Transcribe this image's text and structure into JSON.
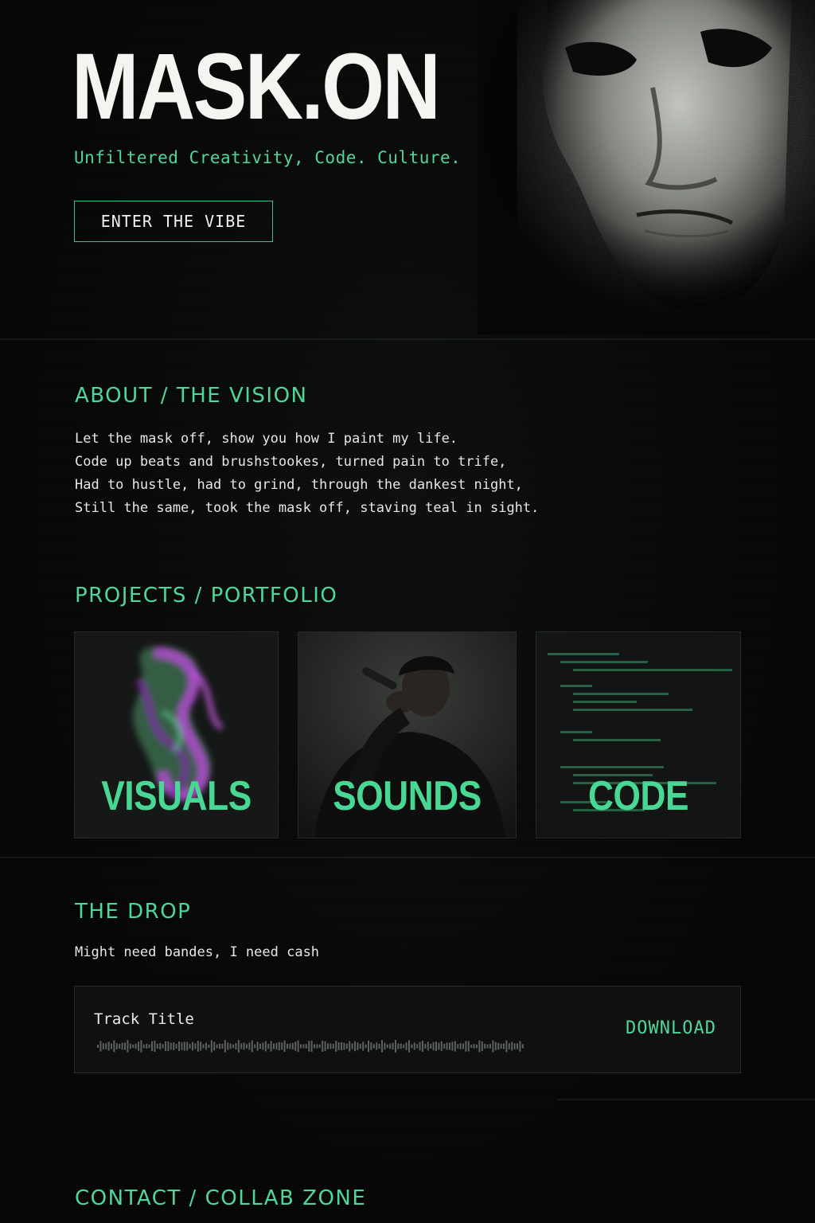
{
  "hero": {
    "title": "MASK.ON",
    "tagline": "Unfiltered Creativity, Code. Culture.",
    "cta_label": "ENTER THE VIBE"
  },
  "about": {
    "heading": "ABOUT / THE VISION",
    "lines": [
      "Let the mask off, show you how I paint my life.",
      "Code up beats and brushstookes, turned pain to trife,",
      "Had to hustle, had to grind, through the dankest night,",
      "Still the same, took the mask off, staving teal in sight."
    ]
  },
  "projects": {
    "heading": "PROJECTS / PORTFOLIO",
    "cards": [
      {
        "label": "VISUALS"
      },
      {
        "label": "SOUNDS"
      },
      {
        "label": "CODE"
      }
    ]
  },
  "drop": {
    "heading": "THE DROP",
    "subtitle": "Might need bandes, I need cash",
    "track_title": "Track Title",
    "download_label": "DOWNLOAD"
  },
  "contact": {
    "heading": "CONTACT / COLLAB ZONE"
  },
  "colors": {
    "accent": "#4fd79a",
    "background": "#060706",
    "text": "#e8ebe6"
  }
}
